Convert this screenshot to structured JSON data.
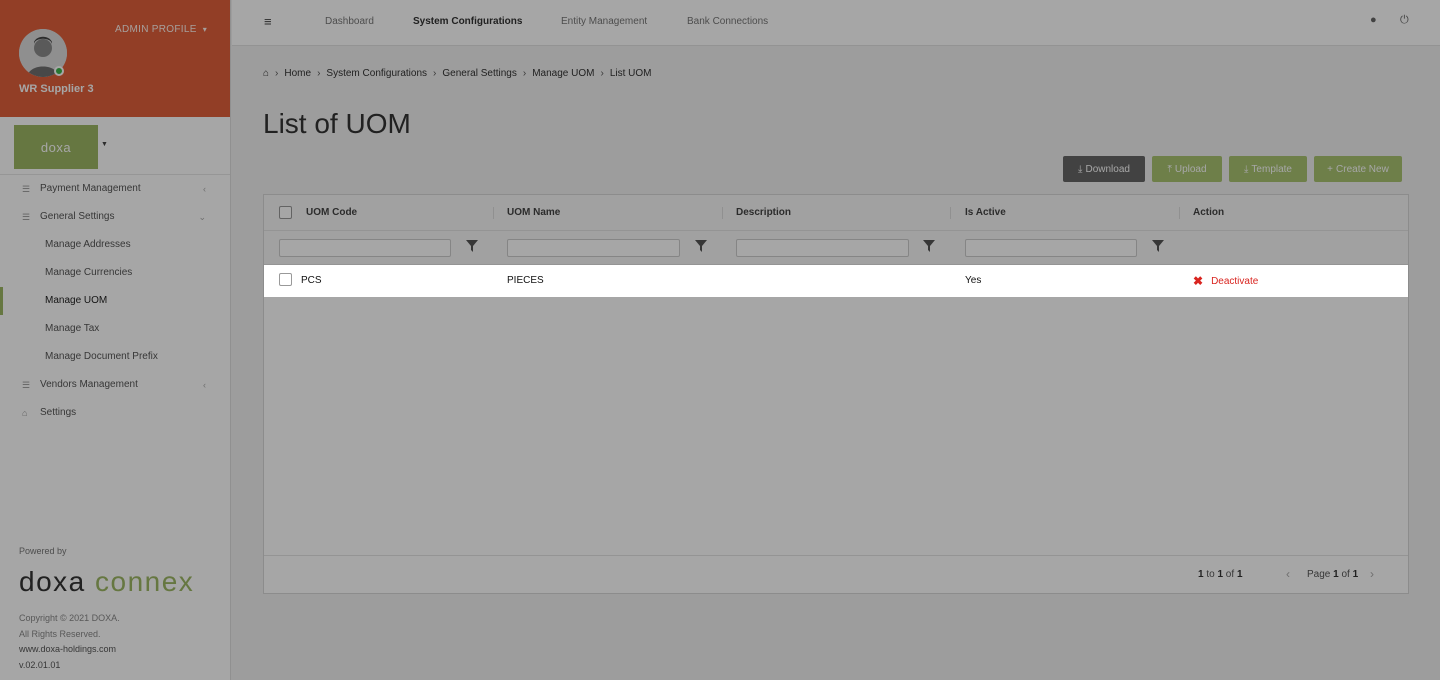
{
  "sidebar": {
    "admin_profile": "ADMIN PROFILE",
    "user_name": "WR Supplier 3",
    "company_logo_text": "doxa",
    "menu": [
      {
        "label": "Payment Management",
        "type": "parent"
      },
      {
        "label": "General Settings",
        "type": "parent"
      },
      {
        "label": "Manage Addresses",
        "type": "child"
      },
      {
        "label": "Manage Currencies",
        "type": "child"
      },
      {
        "label": "Manage UOM",
        "type": "child",
        "active": true
      },
      {
        "label": "Manage Tax",
        "type": "child"
      },
      {
        "label": "Manage Document Prefix",
        "type": "child"
      },
      {
        "label": "Vendors Management",
        "type": "parent"
      },
      {
        "label": "Settings",
        "type": "parent"
      }
    ],
    "powered_by": "Powered by",
    "brand_main": "doxa",
    "brand_accent": "connex",
    "copyright": "Copyright © 2021 DOXA.",
    "rights": "All Rights Reserved.",
    "website": "www.doxa-holdings.com",
    "version": "v.02.01.01"
  },
  "topnav": {
    "items": [
      "Dashboard",
      "System Configurations",
      "Entity Management",
      "Bank Connections"
    ],
    "active": "System Configurations"
  },
  "breadcrumb": [
    "Home",
    "System Configurations",
    "General Settings",
    "Manage UOM",
    "List UOM"
  ],
  "page_title": "List of UOM",
  "buttons": {
    "download": "Download",
    "upload": "Upload",
    "template": "Template",
    "create_new": "Create New"
  },
  "grid": {
    "columns": [
      "UOM Code",
      "UOM Name",
      "Description",
      "Is Active",
      "Action"
    ],
    "rows": [
      {
        "code": "PCS",
        "name": "PIECES",
        "description": "",
        "is_active": "Yes",
        "action": "Deactivate"
      }
    ],
    "footer": {
      "range_from": "1",
      "range_to": "1",
      "total": "1",
      "page": "1",
      "page_total": "1"
    }
  },
  "colors": {
    "profile_bg": "#e0603b",
    "accent_green": "#9db765",
    "danger": "#d9241f"
  }
}
